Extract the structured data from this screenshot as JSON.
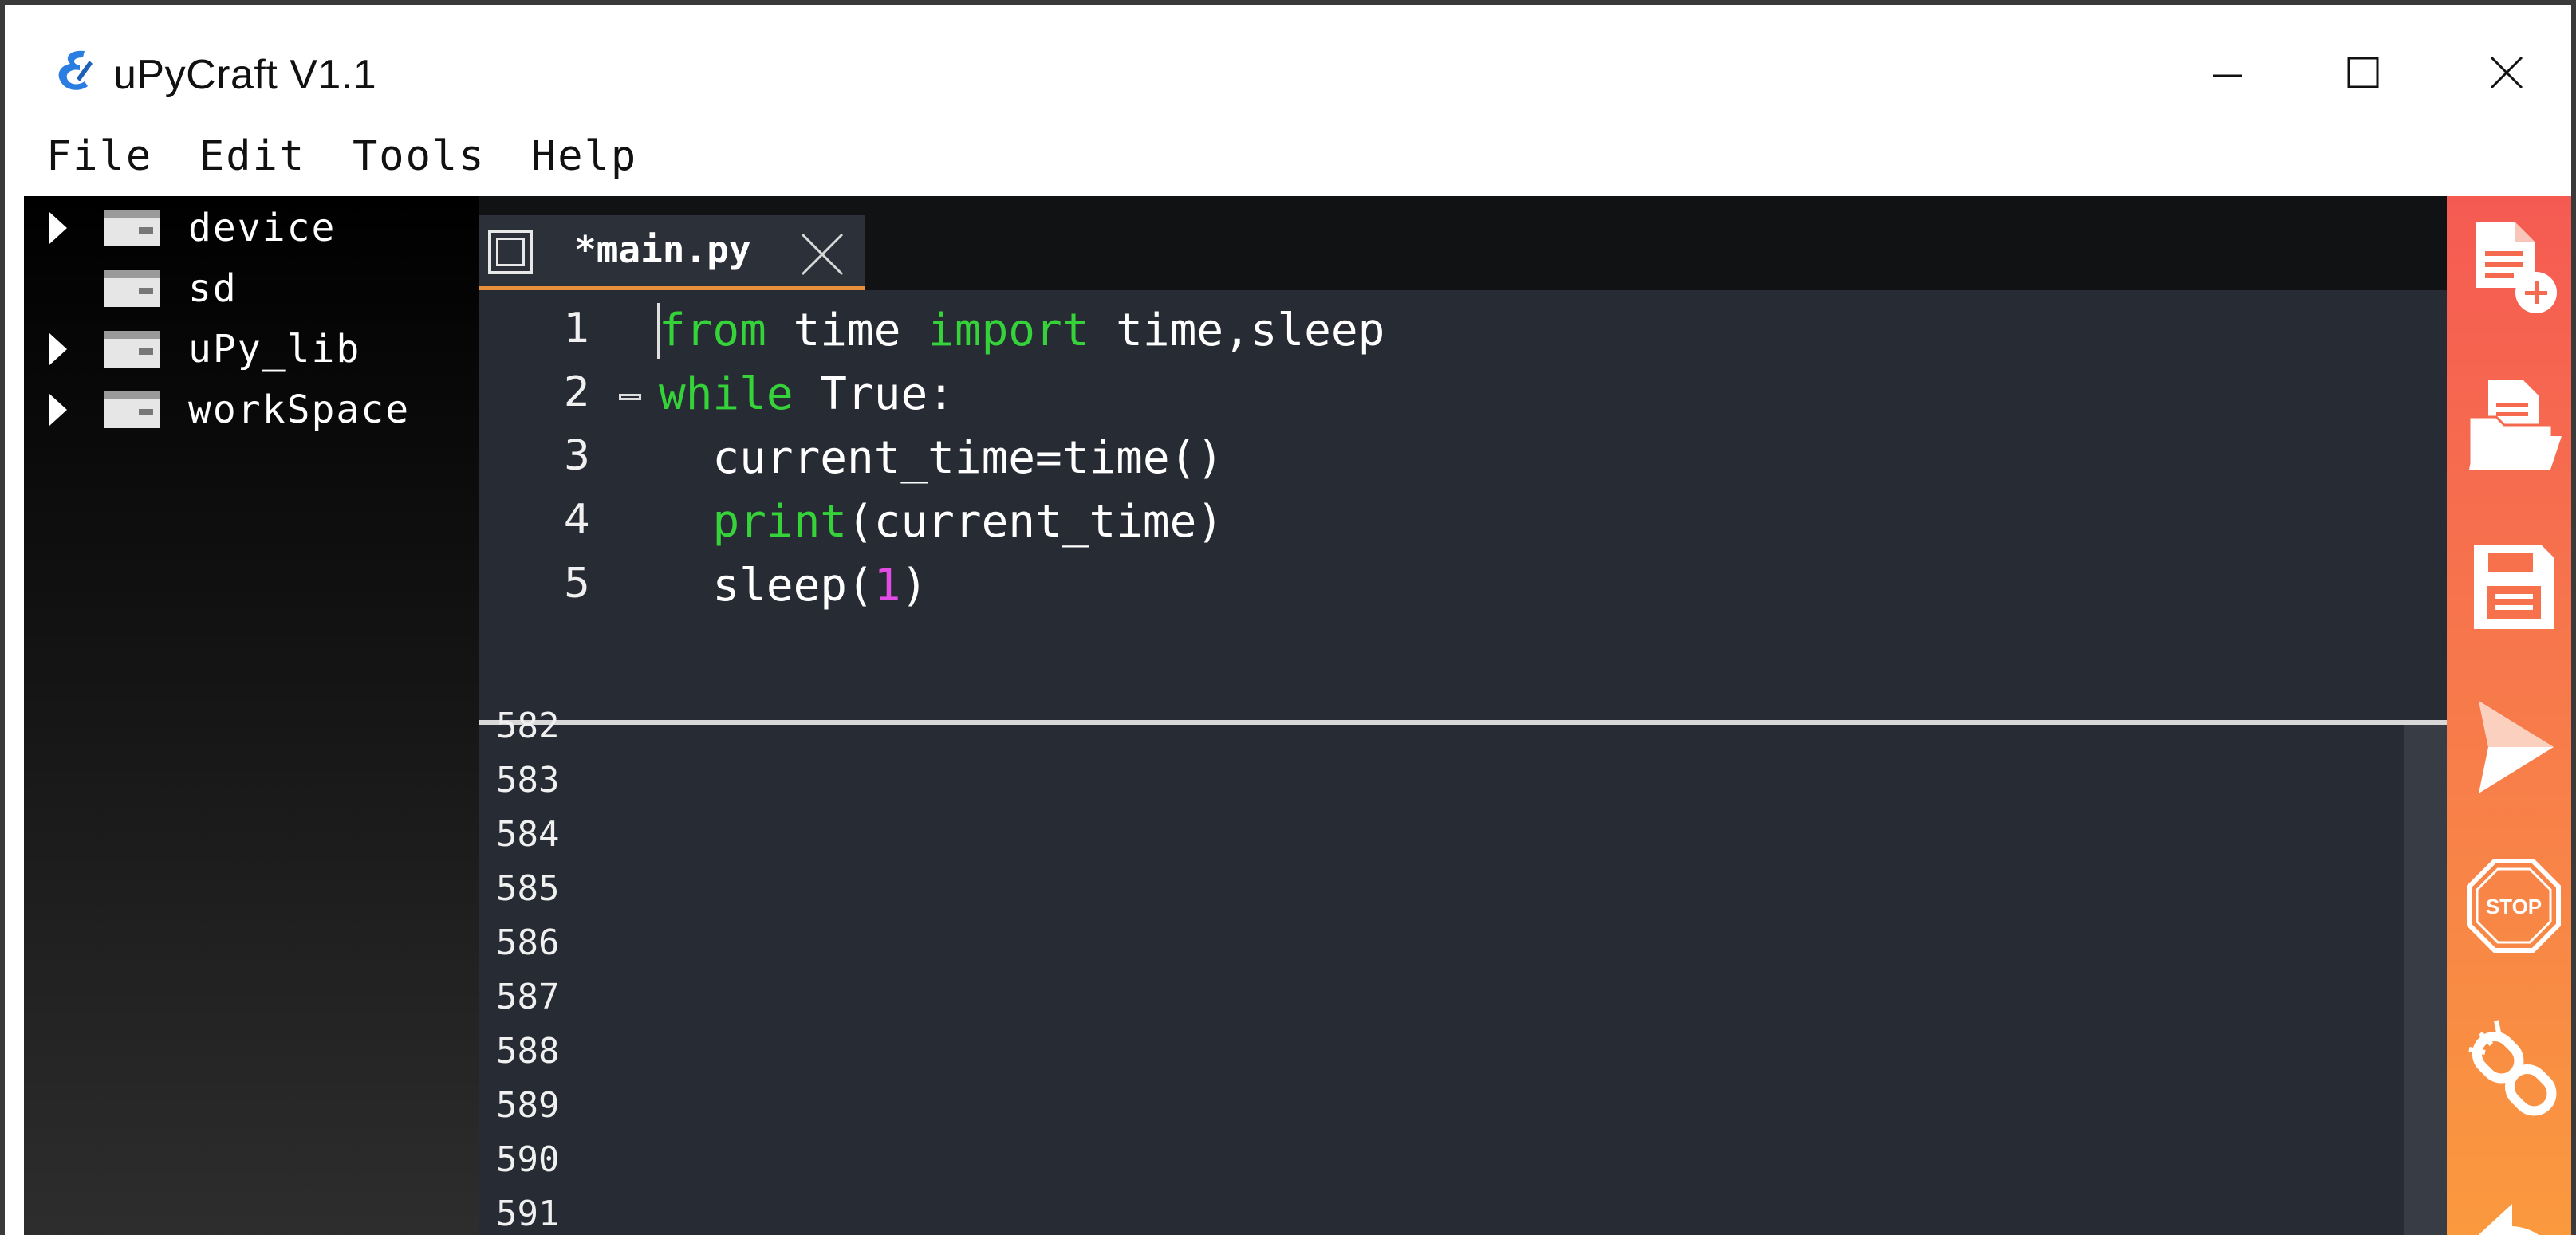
{
  "window": {
    "title": "uPyCraft V1.1",
    "controls": [
      "minimize",
      "maximize",
      "close"
    ]
  },
  "menu": {
    "file": "File",
    "edit": "Edit",
    "tools": "Tools",
    "help": "Help"
  },
  "tree": {
    "items": [
      {
        "label": "device",
        "expandable": true
      },
      {
        "label": "sd",
        "expandable": false
      },
      {
        "label": "uPy_lib",
        "expandable": true
      },
      {
        "label": "workSpace",
        "expandable": true
      }
    ]
  },
  "editor": {
    "tab_label": "*main.py",
    "lines": [
      {
        "num": "1"
      },
      {
        "num": "2"
      },
      {
        "num": "3"
      },
      {
        "num": "4"
      },
      {
        "num": "5"
      }
    ],
    "code": {
      "l1_kw1": "from",
      "l1_mid": " time ",
      "l1_kw2": "import",
      "l1_rest": " time,sleep",
      "l2_kw": "while",
      "l2_rest": " True:",
      "l3": "  current_time=time()",
      "l4_indent": "  ",
      "l4_kw": "print",
      "l4_rest": "(current_time)",
      "l5_a": "  sleep(",
      "l5_num": "1",
      "l5_b": ")"
    }
  },
  "terminal": {
    "lines": [
      "582",
      "583",
      "584",
      "585",
      "586",
      "587",
      "588",
      "589",
      "590",
      "591"
    ]
  },
  "toolbar": {
    "buttons": [
      "new-file-icon",
      "open-file-icon",
      "save-icon",
      "run-icon",
      "stop-icon",
      "connect-icon",
      "undo-icon"
    ]
  },
  "colors": {
    "keyword": "#35d23a",
    "number": "#e24ce5",
    "editor_bg": "#272b33",
    "tab_accent": "#e98e3c",
    "toolbar_top": "#f55a52",
    "toolbar_bottom": "#fa9a3e"
  }
}
